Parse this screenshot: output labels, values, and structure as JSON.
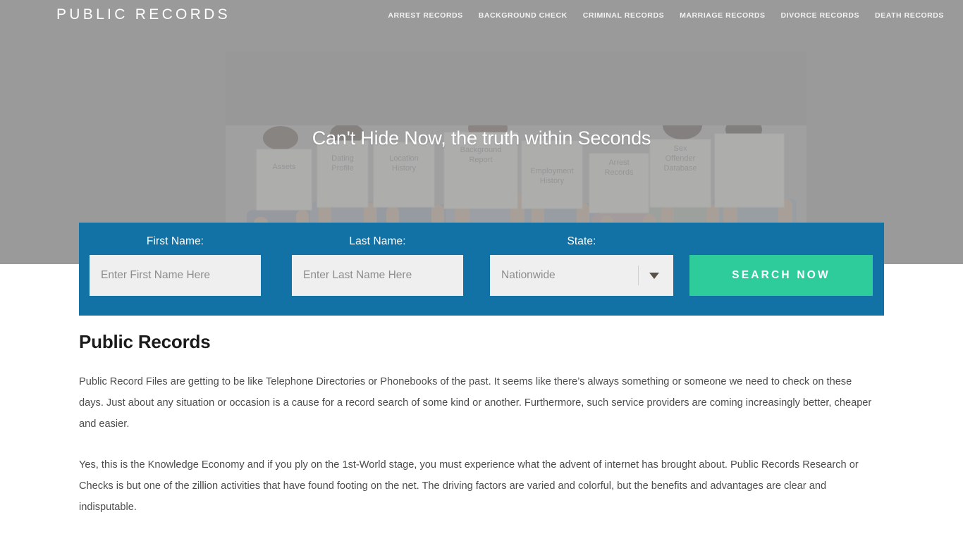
{
  "header": {
    "brand": "PUBLIC RECORDS",
    "nav": [
      {
        "label": "ARREST RECORDS"
      },
      {
        "label": "BACKGROUND CHECK"
      },
      {
        "label": "CRIMINAL RECORDS"
      },
      {
        "label": "MARRIAGE RECORDS"
      },
      {
        "label": "DIVORCE RECORDS"
      },
      {
        "label": "DEATH RECORDS"
      }
    ]
  },
  "hero": {
    "heading": "Can't Hide Now, the truth within Seconds",
    "photo_alt": "people-holding-signs-photo",
    "signs": [
      "Assets",
      "Dating Profile",
      "Location History",
      "Background Report",
      "Employment History",
      "Arrest Records",
      "Sex Offender Database"
    ]
  },
  "search": {
    "first_name_label": "First Name:",
    "first_name_placeholder": "Enter First Name Here",
    "first_name_value": "",
    "last_name_label": "Last Name:",
    "last_name_placeholder": "Enter Last Name Here",
    "last_name_value": "",
    "state_label": "State:",
    "state_value": "Nationwide",
    "state_options": [
      "Nationwide"
    ],
    "submit_label": "SEARCH NOW"
  },
  "content": {
    "title": "Public Records",
    "paragraphs": [
      "Public Record Files are getting to be like Telephone Directories or Phonebooks of the past. It seems like there’s always something or someone we need to check on these days. Just about any situation or occasion is a cause for a record search of some kind or another. Furthermore, such service providers are coming increasingly better, cheaper and easier.",
      "Yes, this is the Knowledge Economy and if you ply on the 1st-World stage, you must experience what the advent of internet has brought about. Public Records Research or Checks is but one of the zillion activities that have found footing on the net. The driving factors are varied and colorful, but the benefits and advantages are clear and indisputable."
    ]
  },
  "colors": {
    "header_bg": "#9a9a9a",
    "hero_bg": "#989898",
    "search_bar_bg": "#1272a5",
    "search_button_bg": "#2ecc9a",
    "input_bg": "#efefef"
  }
}
